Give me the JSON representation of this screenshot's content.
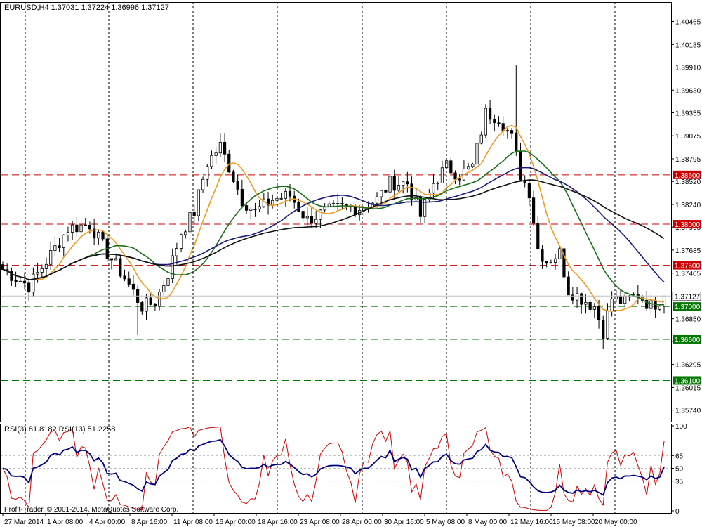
{
  "chart_data": [
    {
      "type": "candlestick",
      "title": "EURUSD,H4  1.37031 1.37224 1.36996 1.37127",
      "ylim": [
        1.356,
        1.407
      ],
      "yticks": [
        1.40465,
        1.40185,
        1.3991,
        1.3963,
        1.39355,
        1.39075,
        1.38795,
        1.3852,
        1.3824,
        1.37965,
        1.37685,
        1.37405,
        1.3685,
        1.36575,
        1.36295,
        1.36015,
        1.3574
      ],
      "xticks": [
        "27 Mar 2014",
        "1 Apr 08:00",
        "4 Apr 00:00",
        "8 Apr 16:00",
        "11 Apr 08:00",
        "16 Apr 00:00",
        "18 Apr 16:00",
        "23 Apr 08:00",
        "28 Apr 00:00",
        "30 Apr 16:00",
        "5 May 08:00",
        "8 May 00:00",
        "12 May 16:00",
        "15 May 08:00",
        "20 May 00:00"
      ],
      "current_price": "1.37127",
      "levels": [
        {
          "value": 1.386,
          "label": "1.38600",
          "color": "#cc0000"
        },
        {
          "value": 1.38,
          "label": "1.38000",
          "color": "#cc0000"
        },
        {
          "value": 1.375,
          "label": "1.37500",
          "color": "#cc0000"
        },
        {
          "value": 1.37,
          "label": "1.37000",
          "color": "#007700"
        },
        {
          "value": 1.366,
          "label": "1.36600",
          "color": "#007700"
        },
        {
          "value": 1.361,
          "label": "1.36100",
          "color": "#007700"
        }
      ],
      "close_anchors": [
        [
          0,
          1.3745
        ],
        [
          6,
          1.3725
        ],
        [
          10,
          1.3755
        ],
        [
          15,
          1.3795
        ],
        [
          20,
          1.38
        ],
        [
          24,
          1.3765
        ],
        [
          28,
          1.3735
        ],
        [
          32,
          1.37
        ],
        [
          35,
          1.3705
        ],
        [
          38,
          1.374
        ],
        [
          41,
          1.379
        ],
        [
          44,
          1.3815
        ],
        [
          47,
          1.3875
        ],
        [
          50,
          1.3895
        ],
        [
          52,
          1.387
        ],
        [
          55,
          1.383
        ],
        [
          58,
          1.3815
        ],
        [
          62,
          1.383
        ],
        [
          66,
          1.3835
        ],
        [
          70,
          1.3805
        ],
        [
          74,
          1.3815
        ],
        [
          78,
          1.382
        ],
        [
          82,
          1.382
        ],
        [
          86,
          1.383
        ],
        [
          89,
          1.385
        ],
        [
          93,
          1.385
        ],
        [
          96,
          1.381
        ],
        [
          99,
          1.385
        ],
        [
          102,
          1.387
        ],
        [
          105,
          1.386
        ],
        [
          108,
          1.387
        ],
        [
          111,
          1.3935
        ],
        [
          114,
          1.393
        ],
        [
          117,
          1.3905
        ],
        [
          119,
          1.386
        ],
        [
          121,
          1.384
        ],
        [
          123,
          1.377
        ],
        [
          125,
          1.3755
        ],
        [
          128,
          1.3765
        ],
        [
          130,
          1.372
        ],
        [
          133,
          1.371
        ],
        [
          136,
          1.37
        ],
        [
          138,
          1.367
        ],
        [
          140,
          1.371
        ],
        [
          143,
          1.3705
        ],
        [
          146,
          1.3715
        ],
        [
          149,
          1.37
        ],
        [
          152,
          1.3712
        ]
      ],
      "series": [
        {
          "name": "",
          "color": "#f09a20",
          "ma": 8
        },
        {
          "name": "",
          "color": "#1a6e1a",
          "ma": 20
        },
        {
          "name": "",
          "color": "#1a1a80",
          "ma": 34
        },
        {
          "name": "",
          "color": "#111111",
          "ma": 50
        }
      ]
    },
    {
      "type": "line",
      "title": "RSI(3) 81.8182  RSI(13) 51.2258",
      "ylim": [
        0,
        100
      ],
      "yticks": [
        100,
        65,
        50,
        35,
        0
      ],
      "series": [
        {
          "name": "RSI(3)",
          "color": "#cc0000",
          "last": 81.8182
        },
        {
          "name": "RSI(13)",
          "color": "#000080",
          "last": 51.2258
        }
      ]
    }
  ],
  "copyright": "Profit-Trader, © 2001-2014, MetaQuotes Software Corp."
}
